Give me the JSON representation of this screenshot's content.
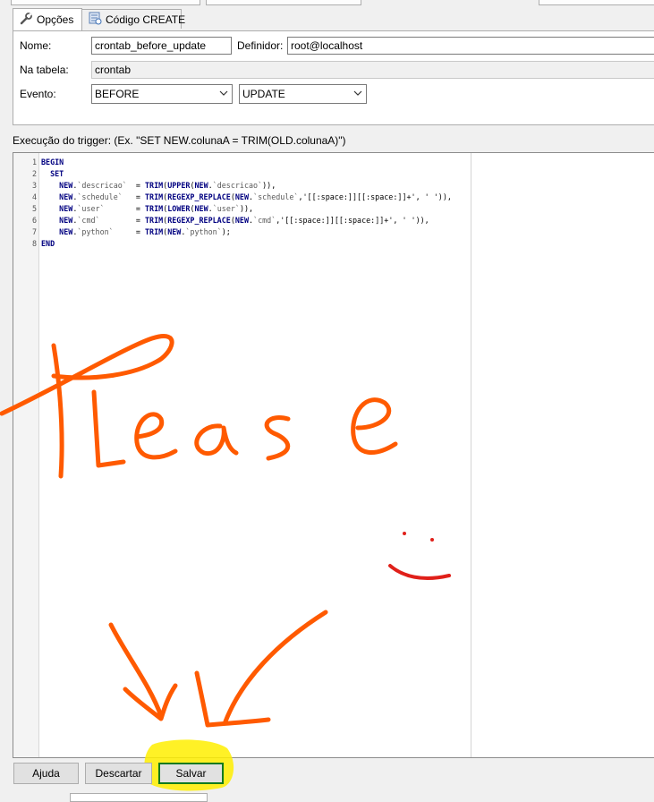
{
  "tabs": [
    {
      "label": "Opções",
      "icon": "wrench-icon"
    },
    {
      "label": "Código CREATE",
      "icon": "script-icon"
    }
  ],
  "form": {
    "name_label": "Nome:",
    "name_value": "crontab_before_update",
    "definer_label": "Definidor:",
    "definer_value": "root@localhost",
    "table_label": "Na tabela:",
    "table_value": "crontab",
    "event_label": "Evento:",
    "timing_value": "BEFORE",
    "event_value": "UPDATE"
  },
  "execution_label": "Execução do trigger: (Ex. \"SET NEW.colunaA = TRIM(OLD.colunaA)\")",
  "code_lines": [
    {
      "n": "1",
      "text": "BEGIN"
    },
    {
      "n": "2",
      "text": "  SET"
    },
    {
      "n": "3",
      "text": "    NEW.`descricao`  = TRIM(UPPER(NEW.`descricao`)),"
    },
    {
      "n": "4",
      "text": "    NEW.`schedule`   = TRIM(REGEXP_REPLACE(NEW.`schedule`,'[[:space:]][[:space:]]+', ' ')),"
    },
    {
      "n": "5",
      "text": "    NEW.`user`       = TRIM(LOWER(NEW.`user`)),"
    },
    {
      "n": "6",
      "text": "    NEW.`cmd`        = TRIM(REGEXP_REPLACE(NEW.`cmd`,'[[:space:]][[:space:]]+', ' ')),"
    },
    {
      "n": "7",
      "text": "    NEW.`python`     = TRIM(NEW.`python`);"
    },
    {
      "n": "8",
      "text": "END"
    }
  ],
  "annotation": {
    "text": "Please",
    "ink_color": "#ff5a00",
    "smile_color": "#e0201a",
    "highlight_color": "#ffee00"
  },
  "buttons": {
    "help": "Ajuda",
    "discard": "Descartar",
    "save": "Salvar"
  }
}
